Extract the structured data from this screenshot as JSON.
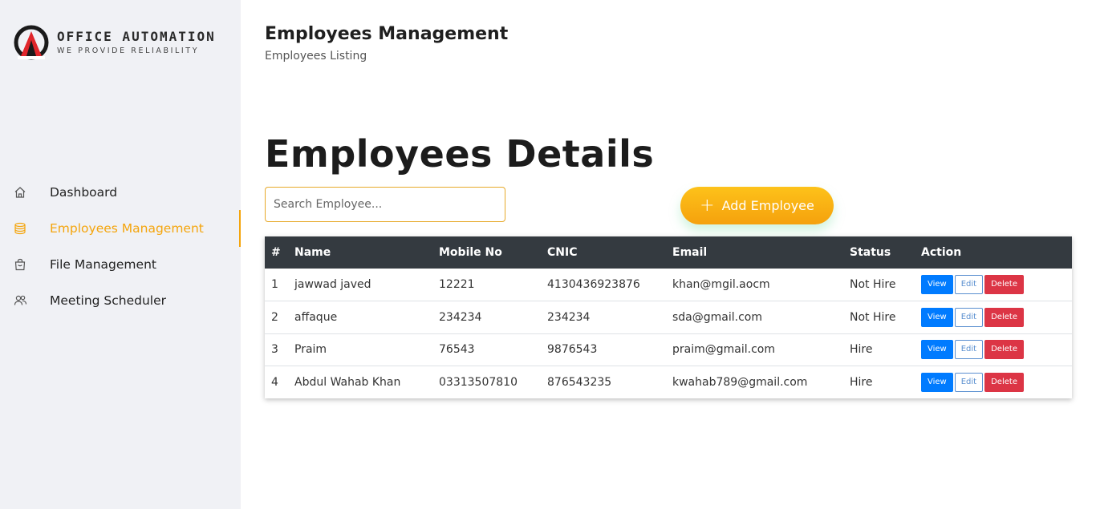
{
  "brand": {
    "title": "OFFICE AUTOMATION",
    "subtitle": "WE PROVIDE RELIABILITY",
    "accent": "#f4a50d",
    "logo_red": "#e0262b"
  },
  "sidebar": {
    "items": [
      {
        "label": "Dashboard",
        "icon": "home-icon",
        "active": false
      },
      {
        "label": "Employees Management",
        "icon": "database-icon",
        "active": true
      },
      {
        "label": "File Management",
        "icon": "bag-icon",
        "active": false
      },
      {
        "label": "Meeting Scheduler",
        "icon": "users-icon",
        "active": false
      }
    ]
  },
  "header": {
    "title": "Employees Management",
    "subtitle": "Employees Listing"
  },
  "main": {
    "section_title": "Employees Details",
    "search_placeholder": "Search Employee...",
    "search_value": "",
    "add_button": "Add Employee"
  },
  "table": {
    "columns": [
      "#",
      "Name",
      "Mobile No",
      "CNIC",
      "Email",
      "Status",
      "Action"
    ],
    "rows": [
      {
        "num": "1",
        "name": "jawwad javed",
        "mobile": "12221",
        "cnic": "4130436923876",
        "email": "khan@mgil.aocm",
        "status": "Not Hire"
      },
      {
        "num": "2",
        "name": "affaque",
        "mobile": "234234",
        "cnic": "234234",
        "email": "sda@gmail.com",
        "status": "Not Hire"
      },
      {
        "num": "3",
        "name": "Praim",
        "mobile": "76543",
        "cnic": "9876543",
        "email": "praim@gmail.com",
        "status": "Hire"
      },
      {
        "num": "4",
        "name": "Abdul Wahab Khan",
        "mobile": "03313507810",
        "cnic": "876543235",
        "email": "kwahab789@gmail.com",
        "status": "Hire"
      }
    ],
    "actions": {
      "view": "View",
      "edit": "Edit",
      "delete": "Delete"
    }
  }
}
